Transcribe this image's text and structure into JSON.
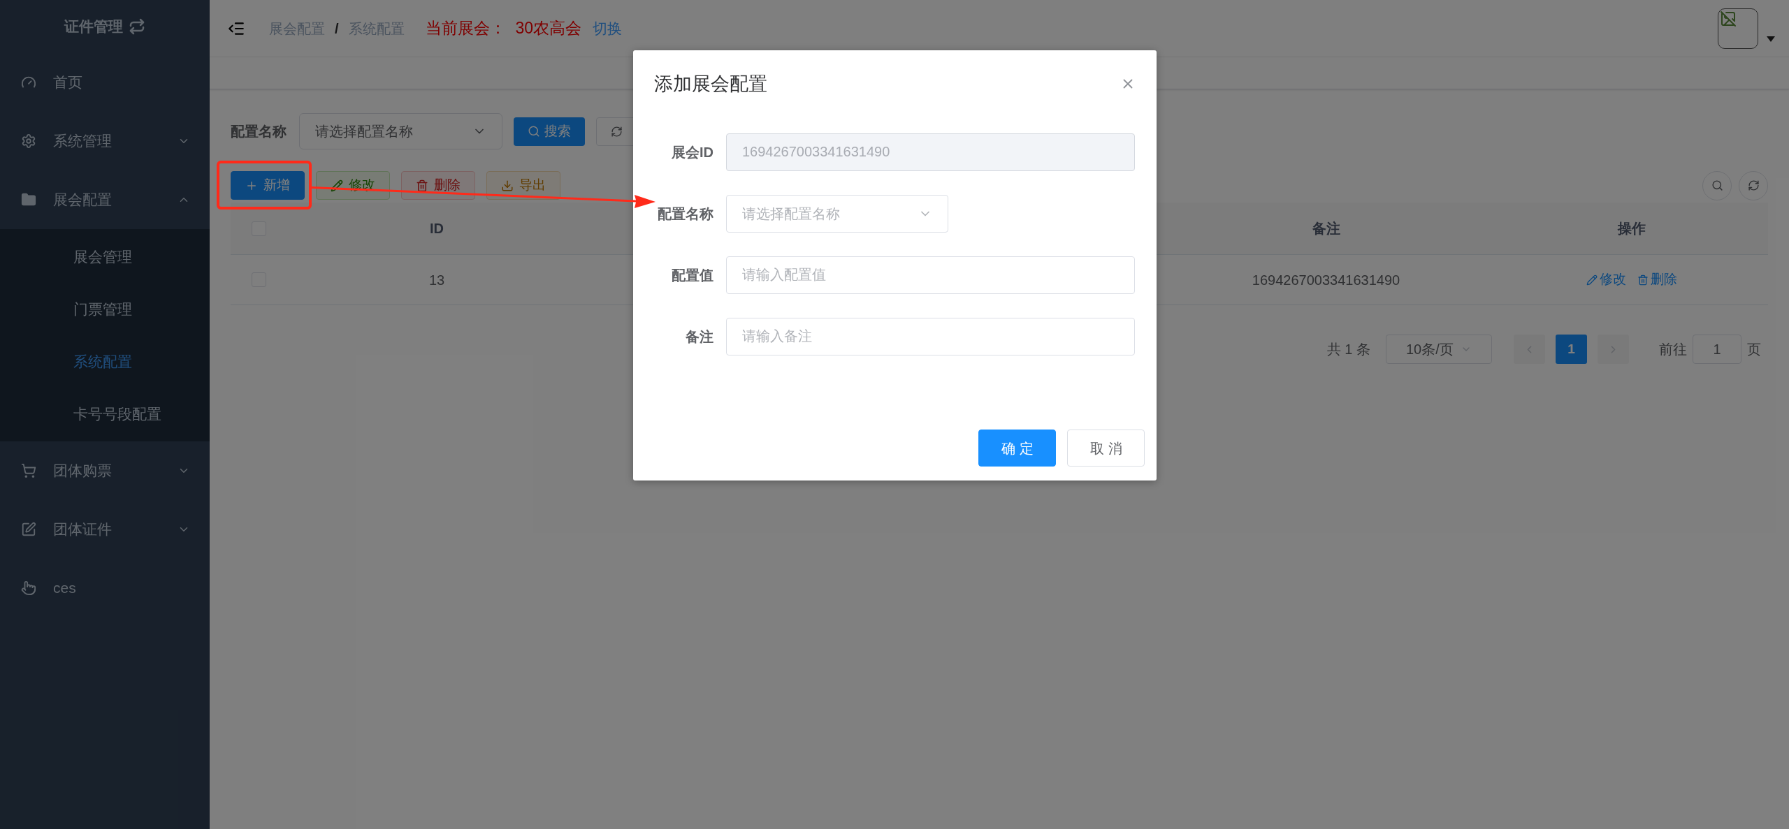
{
  "sidebar": {
    "title": "证件管理",
    "items": [
      {
        "label": "首页",
        "kind": "link"
      },
      {
        "label": "系统管理",
        "kind": "submenu",
        "expanded": false
      },
      {
        "label": "展会配置",
        "kind": "submenu",
        "expanded": true,
        "children": [
          {
            "label": "展会管理",
            "selected": false
          },
          {
            "label": "门票管理",
            "selected": false
          },
          {
            "label": "系统配置",
            "selected": true
          },
          {
            "label": "卡号号段配置",
            "selected": false
          }
        ]
      },
      {
        "label": "团体购票",
        "kind": "submenu",
        "expanded": false
      },
      {
        "label": "团体证件",
        "kind": "submenu",
        "expanded": false
      },
      {
        "label": "ces",
        "kind": "link"
      }
    ]
  },
  "header": {
    "breadcrumb": [
      "展会配置",
      "系统配置"
    ],
    "breadcrumb_separator": "/",
    "current_label": "当前展会：",
    "current_name": "30农高会",
    "switch_link": "切换"
  },
  "search_form": {
    "label": "配置名称",
    "placeholder": "请选择配置名称",
    "search_button": "搜索"
  },
  "toolbar": [
    {
      "label": "新增",
      "kind": "primary",
      "disabled": false
    },
    {
      "label": "修改",
      "kind": "success",
      "disabled": true
    },
    {
      "label": "删除",
      "kind": "danger",
      "disabled": true
    },
    {
      "label": "导出",
      "kind": "warning",
      "disabled": true
    }
  ],
  "table": {
    "select_all_checked": false,
    "columns": [
      "ID",
      "备注",
      "操作"
    ],
    "rows": [
      {
        "checked": false,
        "id": "13",
        "remark": "1694267003341631490",
        "actions": [
          "修改",
          "删除"
        ]
      }
    ]
  },
  "pagination": {
    "total": "共 1 条",
    "page_size": "10条/页",
    "pages": [
      {
        "label": "1",
        "selected": true
      }
    ],
    "goto_label": "前往",
    "goto_value": "1",
    "goto_suffix": "页"
  },
  "dialog": {
    "title": "添加展会配置",
    "fields": [
      {
        "label": "展会ID",
        "kind": "input",
        "value": "1694267003341631490",
        "disabled": true
      },
      {
        "label": "配置名称",
        "kind": "select",
        "placeholder": "请选择配置名称",
        "disabled": false
      },
      {
        "label": "配置值",
        "kind": "input",
        "placeholder": "请输入配置值",
        "disabled": false
      },
      {
        "label": "备注",
        "kind": "input",
        "placeholder": "请输入备注",
        "disabled": false
      }
    ],
    "buttons": [
      {
        "label": "确定",
        "kind": "primary"
      },
      {
        "label": "取消",
        "kind": "default"
      }
    ]
  }
}
